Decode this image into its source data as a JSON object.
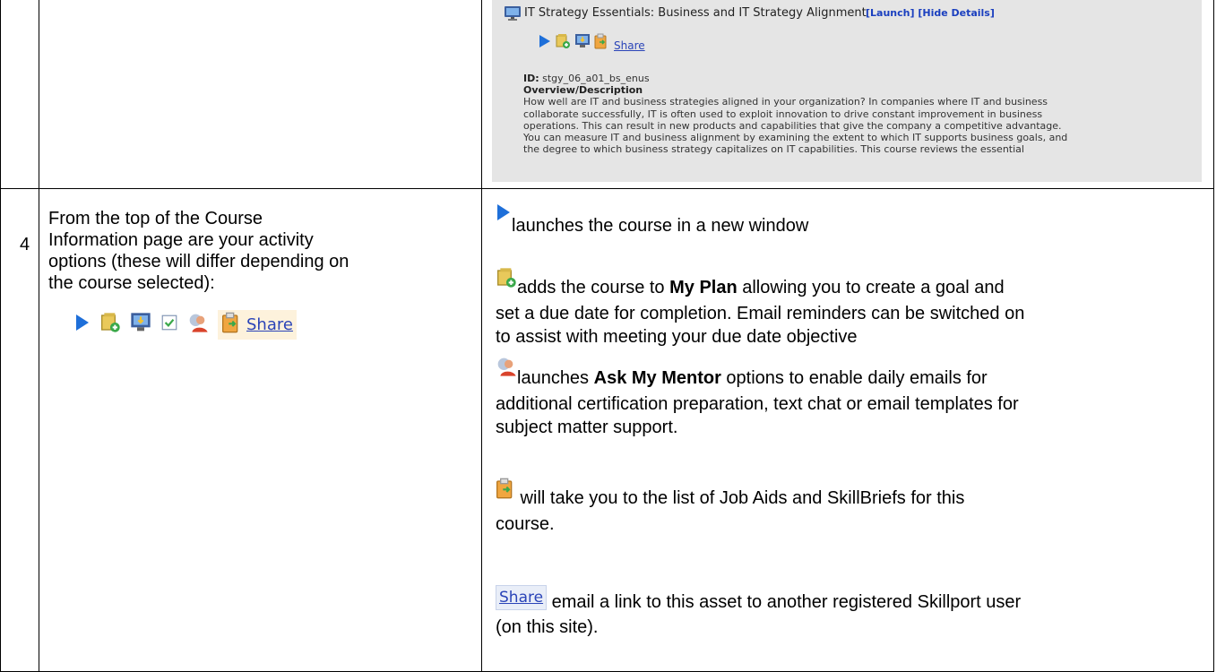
{
  "top_row": {
    "screenshot": {
      "title": "IT Strategy Essentials: Business and IT Strategy Alignment",
      "actions": "[Launch] [Hide Details]",
      "share_label": "Share",
      "id_label": "ID:",
      "id_value": "stgy_06_a01_bs_enus",
      "overview_heading": "Overview/Description",
      "description_lines": [
        "How well are IT and business strategies aligned in your organization? In companies where IT and business",
        "collaborate successfully, IT is often used to exploit innovation to drive constant improvement in business",
        "operations. This can result in new products and capabilities that give the company a competitive advantage.",
        "You can measure IT and business alignment by examining the extent to which IT supports business goals, and",
        "the degree to which business strategy capitalizes on IT capabilities. This course reviews the essential"
      ]
    }
  },
  "row4": {
    "number": "4",
    "instruction": "From the top of the Course Information page are your activity options (these will differ depending on the course selected):",
    "options_share_label": "Share",
    "items": {
      "launch": "launches the course in a new window",
      "plan_pre": "adds the course to ",
      "plan_bold": "My Plan",
      "plan_line1_post": " allowing you to create a goal and",
      "plan_line2": "set a due date for completion.  Email reminders can be switched on",
      "plan_line3": "to assist with meeting your due date objective",
      "mentor_pre": "launches ",
      "mentor_bold": "Ask My Mentor",
      "mentor_line1_post": " options to enable daily emails for",
      "mentor_line2": "additional certification preparation, text chat or email templates for",
      "mentor_line3": "subject matter support.",
      "jobaids_line1": " will take you to the list of Job Aids and SkillBriefs for this",
      "jobaids_line2": "course.",
      "share_badge": "Share",
      "share_line1": " email a link to this asset to another registered Skillport user",
      "share_line2": "(on this site)."
    }
  },
  "colors": {
    "border": "#000000",
    "link": "#2a44b8",
    "launch_blue": "#1e6fd9",
    "screenshot_bg": "#e5e5e5"
  },
  "icons": [
    "computer-icon",
    "play-icon",
    "add-to-plan-icon",
    "download-icon",
    "checklist-icon",
    "mentor-icon",
    "job-aids-icon"
  ]
}
